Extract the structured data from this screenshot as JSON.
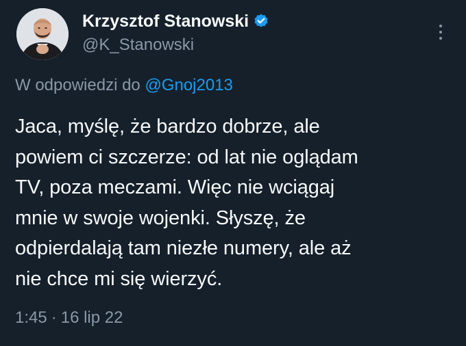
{
  "author": {
    "display_name": "Krzysztof Stanowski",
    "handle": "@K_Stanowski",
    "verified_icon": "verified-badge-icon"
  },
  "reply_context": {
    "prefix": "W odpowiedzi do",
    "mention": "@Gnoj2013"
  },
  "tweet": {
    "text": "Jaca, myślę, że bardzo dobrze, ale\npowiem ci szczerze: od lat nie oglądam\nTV, poza meczami. Więc nie wciągaj\nmnie w swoje wojenki. Słyszę, że\nodpierdalają tam niezłe numery, ale aż\nnie chce mi się wierzyć.",
    "time": "1:45",
    "separator": "·",
    "date": "16 lip 22"
  },
  "colors": {
    "background": "#15202b",
    "primary_text": "#f7f9f9",
    "secondary_text": "#8b98a5",
    "accent": "#1d9bf0"
  },
  "icons": {
    "more": "more-options-icon"
  }
}
